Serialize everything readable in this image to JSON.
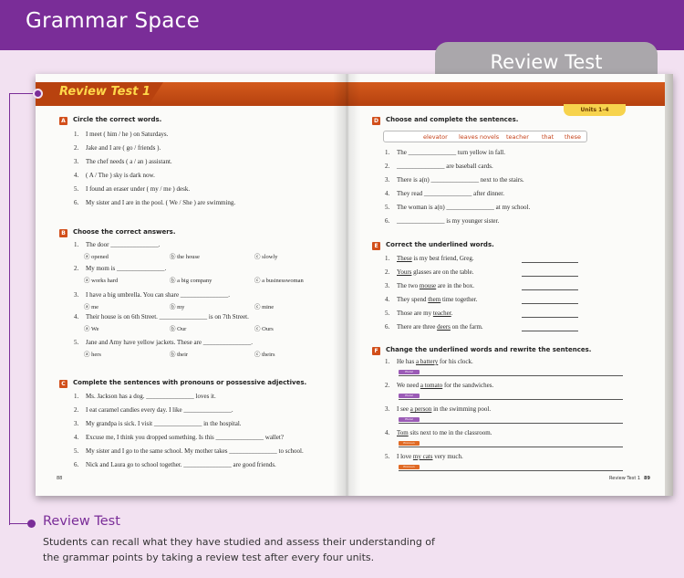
{
  "header": {
    "title": "Grammar Space",
    "tab": "Review Test"
  },
  "book": {
    "left": {
      "title": "Review Test 1",
      "page_number": "88",
      "sectionA": {
        "letter": "A",
        "title": "Circle the correct words.",
        "items": [
          "I meet ( him / he ) on Saturdays.",
          "Jake and I are ( go / friends ).",
          "The chef needs ( a / an ) assistant.",
          "( A / The ) sky is dark now.",
          "I found an eraser under ( my / me ) desk.",
          "My sister and I are in the pool. ( We / She ) are swimming."
        ]
      },
      "sectionB": {
        "letter": "B",
        "title": "Choose the correct answers.",
        "items": [
          {
            "q": "The door _______________.",
            "opts": [
              "ⓐ opened",
              "ⓑ the house",
              "ⓒ slowly"
            ]
          },
          {
            "q": "My mom is _______________.",
            "opts": [
              "ⓐ works hard",
              "ⓑ a big company",
              "ⓒ a businesswoman"
            ]
          },
          {
            "q": "I have a big umbrella. You can share _______________.",
            "opts": [
              "ⓐ me",
              "ⓑ my",
              "ⓒ mine"
            ]
          },
          {
            "q": "Their house is on 6th Street. _______________ is on 7th Street.",
            "opts": [
              "ⓐ We",
              "ⓑ Our",
              "ⓒ Ours"
            ]
          },
          {
            "q": "Jane and Amy have yellow jackets. These are _______________.",
            "opts": [
              "ⓐ hers",
              "ⓑ their",
              "ⓒ theirs"
            ]
          }
        ]
      },
      "sectionC": {
        "letter": "C",
        "title": "Complete the sentences with pronouns or possessive adjectives.",
        "items": [
          "Ms. Jackson has a dog. _______________ loves it.",
          "I eat caramel candies every day. I like _______________.",
          "My grandpa is sick. I visit _______________ in the hospital.",
          "Excuse me, I think you dropped something. Is this _______________ wallet?",
          "My sister and I go to the same school. My mother takes _______________ to school.",
          "Nick and Laura go to school together. _______________ are good friends."
        ]
      }
    },
    "right": {
      "units": "Units 1–4",
      "page_label": "Review Test 1",
      "page_number": "89",
      "sectionD": {
        "letter": "D",
        "title": "Choose and complete the sentences.",
        "words": [
          "elevator",
          "leaves",
          "novels",
          "teacher",
          "that",
          "these"
        ],
        "items": [
          "The _______________ turn yellow in fall.",
          "_______________ are baseball cards.",
          "There is a(n) _______________ next to the stairs.",
          "They read _______________ after dinner.",
          "The woman is a(n) _______________ at my school.",
          "_______________ is my younger sister."
        ]
      },
      "sectionE": {
        "letter": "E",
        "title": "Correct the underlined words.",
        "items": [
          {
            "pre": "",
            "u": "These",
            "post": " is my best friend, Greg."
          },
          {
            "pre": "",
            "u": "Yours",
            "post": " glasses are on the table."
          },
          {
            "pre": "The two ",
            "u": "mouse",
            "post": " are in the box."
          },
          {
            "pre": "They spend ",
            "u": "them",
            "post": " time together."
          },
          {
            "pre": "Those are my ",
            "u": "teacher",
            "post": "."
          },
          {
            "pre": "There are three ",
            "u": "deers",
            "post": " on the farm."
          }
        ]
      },
      "sectionF": {
        "letter": "F",
        "title": "Change the underlined words and rewrite the sentences.",
        "items": [
          {
            "pre": "He has ",
            "u": "a battery",
            "post": " for his clock.",
            "badge": "Plural"
          },
          {
            "pre": "We need ",
            "u": "a tomato",
            "post": " for the sandwiches.",
            "badge": "Plural"
          },
          {
            "pre": "I see ",
            "u": "a person",
            "post": " in the swimming pool.",
            "badge": "Plural"
          },
          {
            "pre": "",
            "u": "Tom",
            "post": " sits next to me in the classroom.",
            "badge": "Pronoun"
          },
          {
            "pre": "I love ",
            "u": "my cats",
            "post": " very much.",
            "badge": "Pronoun"
          }
        ]
      }
    }
  },
  "caption": {
    "title": "Review Test",
    "description": "Students can recall what they have studied and assess their understanding of the grammar points by taking a review test after every four units."
  },
  "colors": {
    "purple": "#7a2d98",
    "orange": "#d24f1b",
    "plural_badge": "#9b5bb6",
    "pronoun_badge": "#e06a25"
  }
}
